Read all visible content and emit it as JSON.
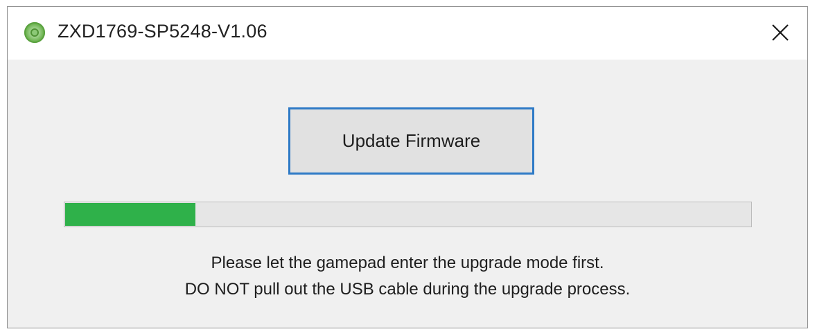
{
  "window": {
    "title": "ZXD1769-SP5248-V1.06",
    "icon": "app-green-circle-icon",
    "close_icon": "close-icon"
  },
  "main": {
    "update_button_label": "Update Firmware",
    "progress": {
      "fraction": 0.19,
      "fill_color": "#2fb14a"
    },
    "message_line1": "Please let the gamepad enter the upgrade mode first.",
    "message_line2": "DO NOT pull out the USB cable during the upgrade process."
  },
  "colors": {
    "button_focus_border": "#2e7ac6",
    "window_background": "#f0f0f0",
    "titlebar_background": "#ffffff"
  }
}
